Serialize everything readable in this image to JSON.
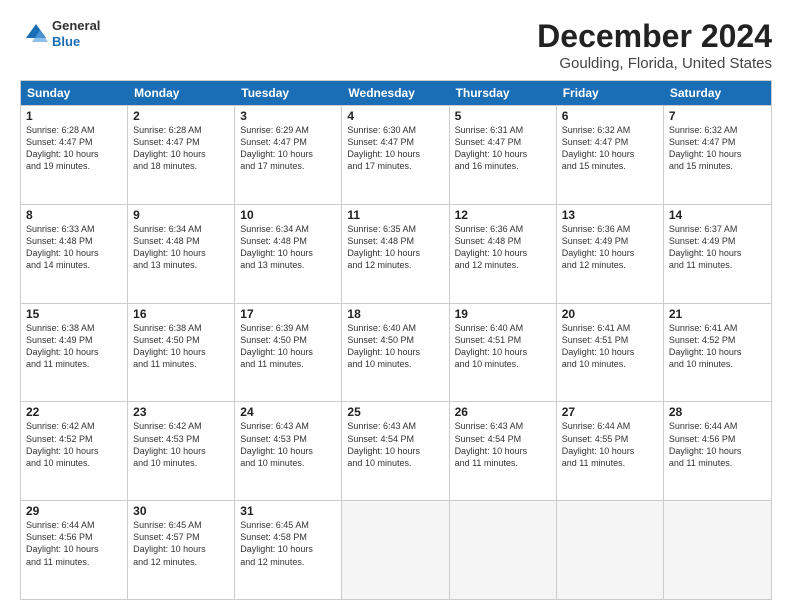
{
  "logo": {
    "line1": "General",
    "line2": "Blue"
  },
  "title": "December 2024",
  "subtitle": "Goulding, Florida, United States",
  "days_of_week": [
    "Sunday",
    "Monday",
    "Tuesday",
    "Wednesday",
    "Thursday",
    "Friday",
    "Saturday"
  ],
  "weeks": [
    [
      {
        "day": 1,
        "info": "Sunrise: 6:28 AM\nSunset: 4:47 PM\nDaylight: 10 hours\nand 19 minutes."
      },
      {
        "day": 2,
        "info": "Sunrise: 6:28 AM\nSunset: 4:47 PM\nDaylight: 10 hours\nand 18 minutes."
      },
      {
        "day": 3,
        "info": "Sunrise: 6:29 AM\nSunset: 4:47 PM\nDaylight: 10 hours\nand 17 minutes."
      },
      {
        "day": 4,
        "info": "Sunrise: 6:30 AM\nSunset: 4:47 PM\nDaylight: 10 hours\nand 17 minutes."
      },
      {
        "day": 5,
        "info": "Sunrise: 6:31 AM\nSunset: 4:47 PM\nDaylight: 10 hours\nand 16 minutes."
      },
      {
        "day": 6,
        "info": "Sunrise: 6:32 AM\nSunset: 4:47 PM\nDaylight: 10 hours\nand 15 minutes."
      },
      {
        "day": 7,
        "info": "Sunrise: 6:32 AM\nSunset: 4:47 PM\nDaylight: 10 hours\nand 15 minutes."
      }
    ],
    [
      {
        "day": 8,
        "info": "Sunrise: 6:33 AM\nSunset: 4:48 PM\nDaylight: 10 hours\nand 14 minutes."
      },
      {
        "day": 9,
        "info": "Sunrise: 6:34 AM\nSunset: 4:48 PM\nDaylight: 10 hours\nand 13 minutes."
      },
      {
        "day": 10,
        "info": "Sunrise: 6:34 AM\nSunset: 4:48 PM\nDaylight: 10 hours\nand 13 minutes."
      },
      {
        "day": 11,
        "info": "Sunrise: 6:35 AM\nSunset: 4:48 PM\nDaylight: 10 hours\nand 12 minutes."
      },
      {
        "day": 12,
        "info": "Sunrise: 6:36 AM\nSunset: 4:48 PM\nDaylight: 10 hours\nand 12 minutes."
      },
      {
        "day": 13,
        "info": "Sunrise: 6:36 AM\nSunset: 4:49 PM\nDaylight: 10 hours\nand 12 minutes."
      },
      {
        "day": 14,
        "info": "Sunrise: 6:37 AM\nSunset: 4:49 PM\nDaylight: 10 hours\nand 11 minutes."
      }
    ],
    [
      {
        "day": 15,
        "info": "Sunrise: 6:38 AM\nSunset: 4:49 PM\nDaylight: 10 hours\nand 11 minutes."
      },
      {
        "day": 16,
        "info": "Sunrise: 6:38 AM\nSunset: 4:50 PM\nDaylight: 10 hours\nand 11 minutes."
      },
      {
        "day": 17,
        "info": "Sunrise: 6:39 AM\nSunset: 4:50 PM\nDaylight: 10 hours\nand 11 minutes."
      },
      {
        "day": 18,
        "info": "Sunrise: 6:40 AM\nSunset: 4:50 PM\nDaylight: 10 hours\nand 10 minutes."
      },
      {
        "day": 19,
        "info": "Sunrise: 6:40 AM\nSunset: 4:51 PM\nDaylight: 10 hours\nand 10 minutes."
      },
      {
        "day": 20,
        "info": "Sunrise: 6:41 AM\nSunset: 4:51 PM\nDaylight: 10 hours\nand 10 minutes."
      },
      {
        "day": 21,
        "info": "Sunrise: 6:41 AM\nSunset: 4:52 PM\nDaylight: 10 hours\nand 10 minutes."
      }
    ],
    [
      {
        "day": 22,
        "info": "Sunrise: 6:42 AM\nSunset: 4:52 PM\nDaylight: 10 hours\nand 10 minutes."
      },
      {
        "day": 23,
        "info": "Sunrise: 6:42 AM\nSunset: 4:53 PM\nDaylight: 10 hours\nand 10 minutes."
      },
      {
        "day": 24,
        "info": "Sunrise: 6:43 AM\nSunset: 4:53 PM\nDaylight: 10 hours\nand 10 minutes."
      },
      {
        "day": 25,
        "info": "Sunrise: 6:43 AM\nSunset: 4:54 PM\nDaylight: 10 hours\nand 10 minutes."
      },
      {
        "day": 26,
        "info": "Sunrise: 6:43 AM\nSunset: 4:54 PM\nDaylight: 10 hours\nand 11 minutes."
      },
      {
        "day": 27,
        "info": "Sunrise: 6:44 AM\nSunset: 4:55 PM\nDaylight: 10 hours\nand 11 minutes."
      },
      {
        "day": 28,
        "info": "Sunrise: 6:44 AM\nSunset: 4:56 PM\nDaylight: 10 hours\nand 11 minutes."
      }
    ],
    [
      {
        "day": 29,
        "info": "Sunrise: 6:44 AM\nSunset: 4:56 PM\nDaylight: 10 hours\nand 11 minutes."
      },
      {
        "day": 30,
        "info": "Sunrise: 6:45 AM\nSunset: 4:57 PM\nDaylight: 10 hours\nand 12 minutes."
      },
      {
        "day": 31,
        "info": "Sunrise: 6:45 AM\nSunset: 4:58 PM\nDaylight: 10 hours\nand 12 minutes."
      },
      null,
      null,
      null,
      null
    ]
  ]
}
